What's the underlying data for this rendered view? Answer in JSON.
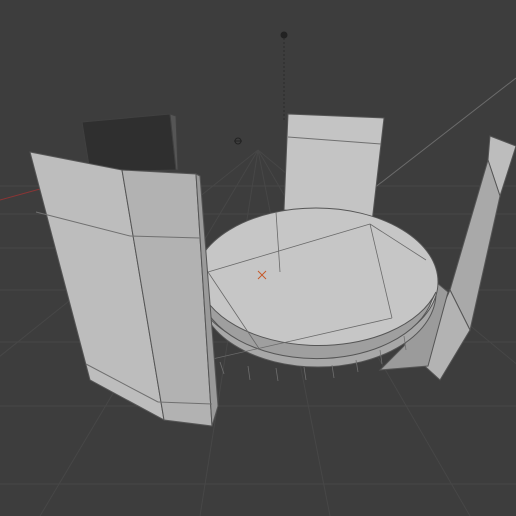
{
  "viewport": {
    "background": "#3d3d3d",
    "grid_color": "#4a4a4a",
    "mesh_fill_light": "#c9c9c9",
    "mesh_fill_mid": "#b4b4b4",
    "mesh_fill_dark": "#8a8a8a",
    "mesh_back_face": "#2e2e2e",
    "wire_color": "#404040",
    "x_axis_color": "#9b3b3b"
  },
  "objects": [
    {
      "name": "pillar-front-left",
      "type": "mesh"
    },
    {
      "name": "pillar-back-left",
      "type": "mesh"
    },
    {
      "name": "pillar-back-center",
      "type": "mesh"
    },
    {
      "name": "pillar-right",
      "type": "mesh"
    },
    {
      "name": "round-platform",
      "type": "mesh"
    }
  ],
  "gizmos": [
    {
      "name": "light-icon"
    },
    {
      "name": "camera-origin-icon"
    },
    {
      "name": "object-origin-icon"
    }
  ]
}
